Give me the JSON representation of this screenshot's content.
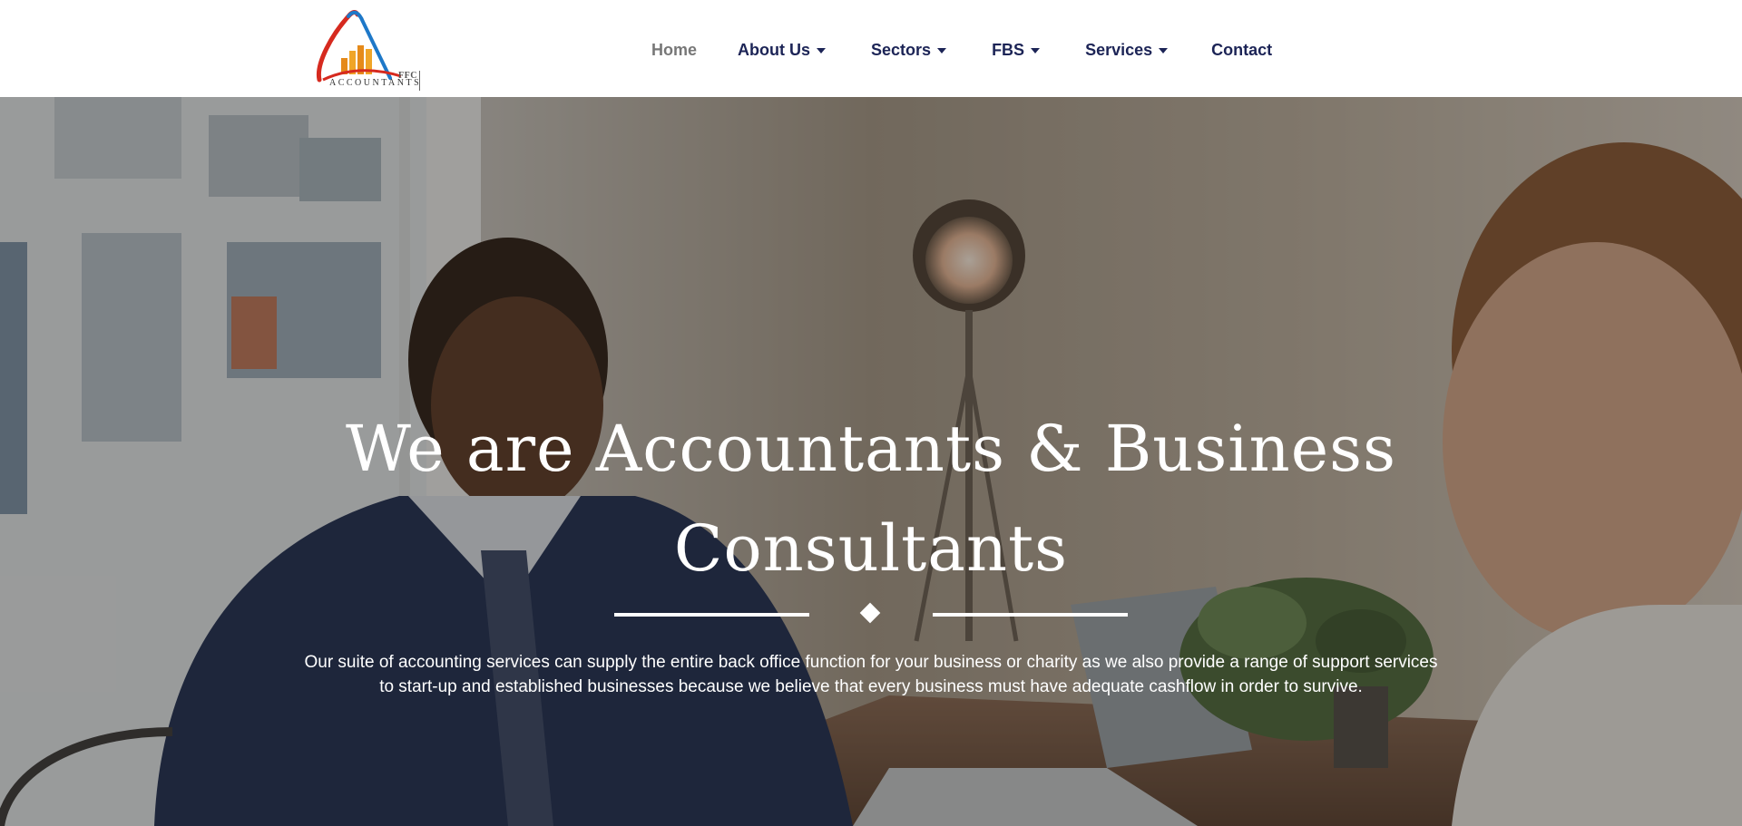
{
  "logo": {
    "ffc_text": "FFC",
    "accountants_text": "ACCOUNTANTS"
  },
  "nav": {
    "items": [
      {
        "label": "Home",
        "active": true,
        "dropdown": false
      },
      {
        "label": "About Us",
        "active": false,
        "dropdown": true
      },
      {
        "label": "Sectors",
        "active": false,
        "dropdown": true
      },
      {
        "label": "FBS",
        "active": false,
        "dropdown": true
      },
      {
        "label": "Services",
        "active": false,
        "dropdown": true
      },
      {
        "label": "Contact",
        "active": false,
        "dropdown": false
      }
    ]
  },
  "hero": {
    "title_line1": "We are Accountants & Business",
    "title_line2": "Consultants",
    "text": "Our suite of accounting services can supply the entire back office function for your business or charity as we also provide a range of support services to start-up and established businesses because we believe that every business must have adequate cashflow in order to survive."
  },
  "colors": {
    "nav_text": "#1c2456",
    "nav_active": "#777777",
    "hero_text": "#ffffff"
  }
}
